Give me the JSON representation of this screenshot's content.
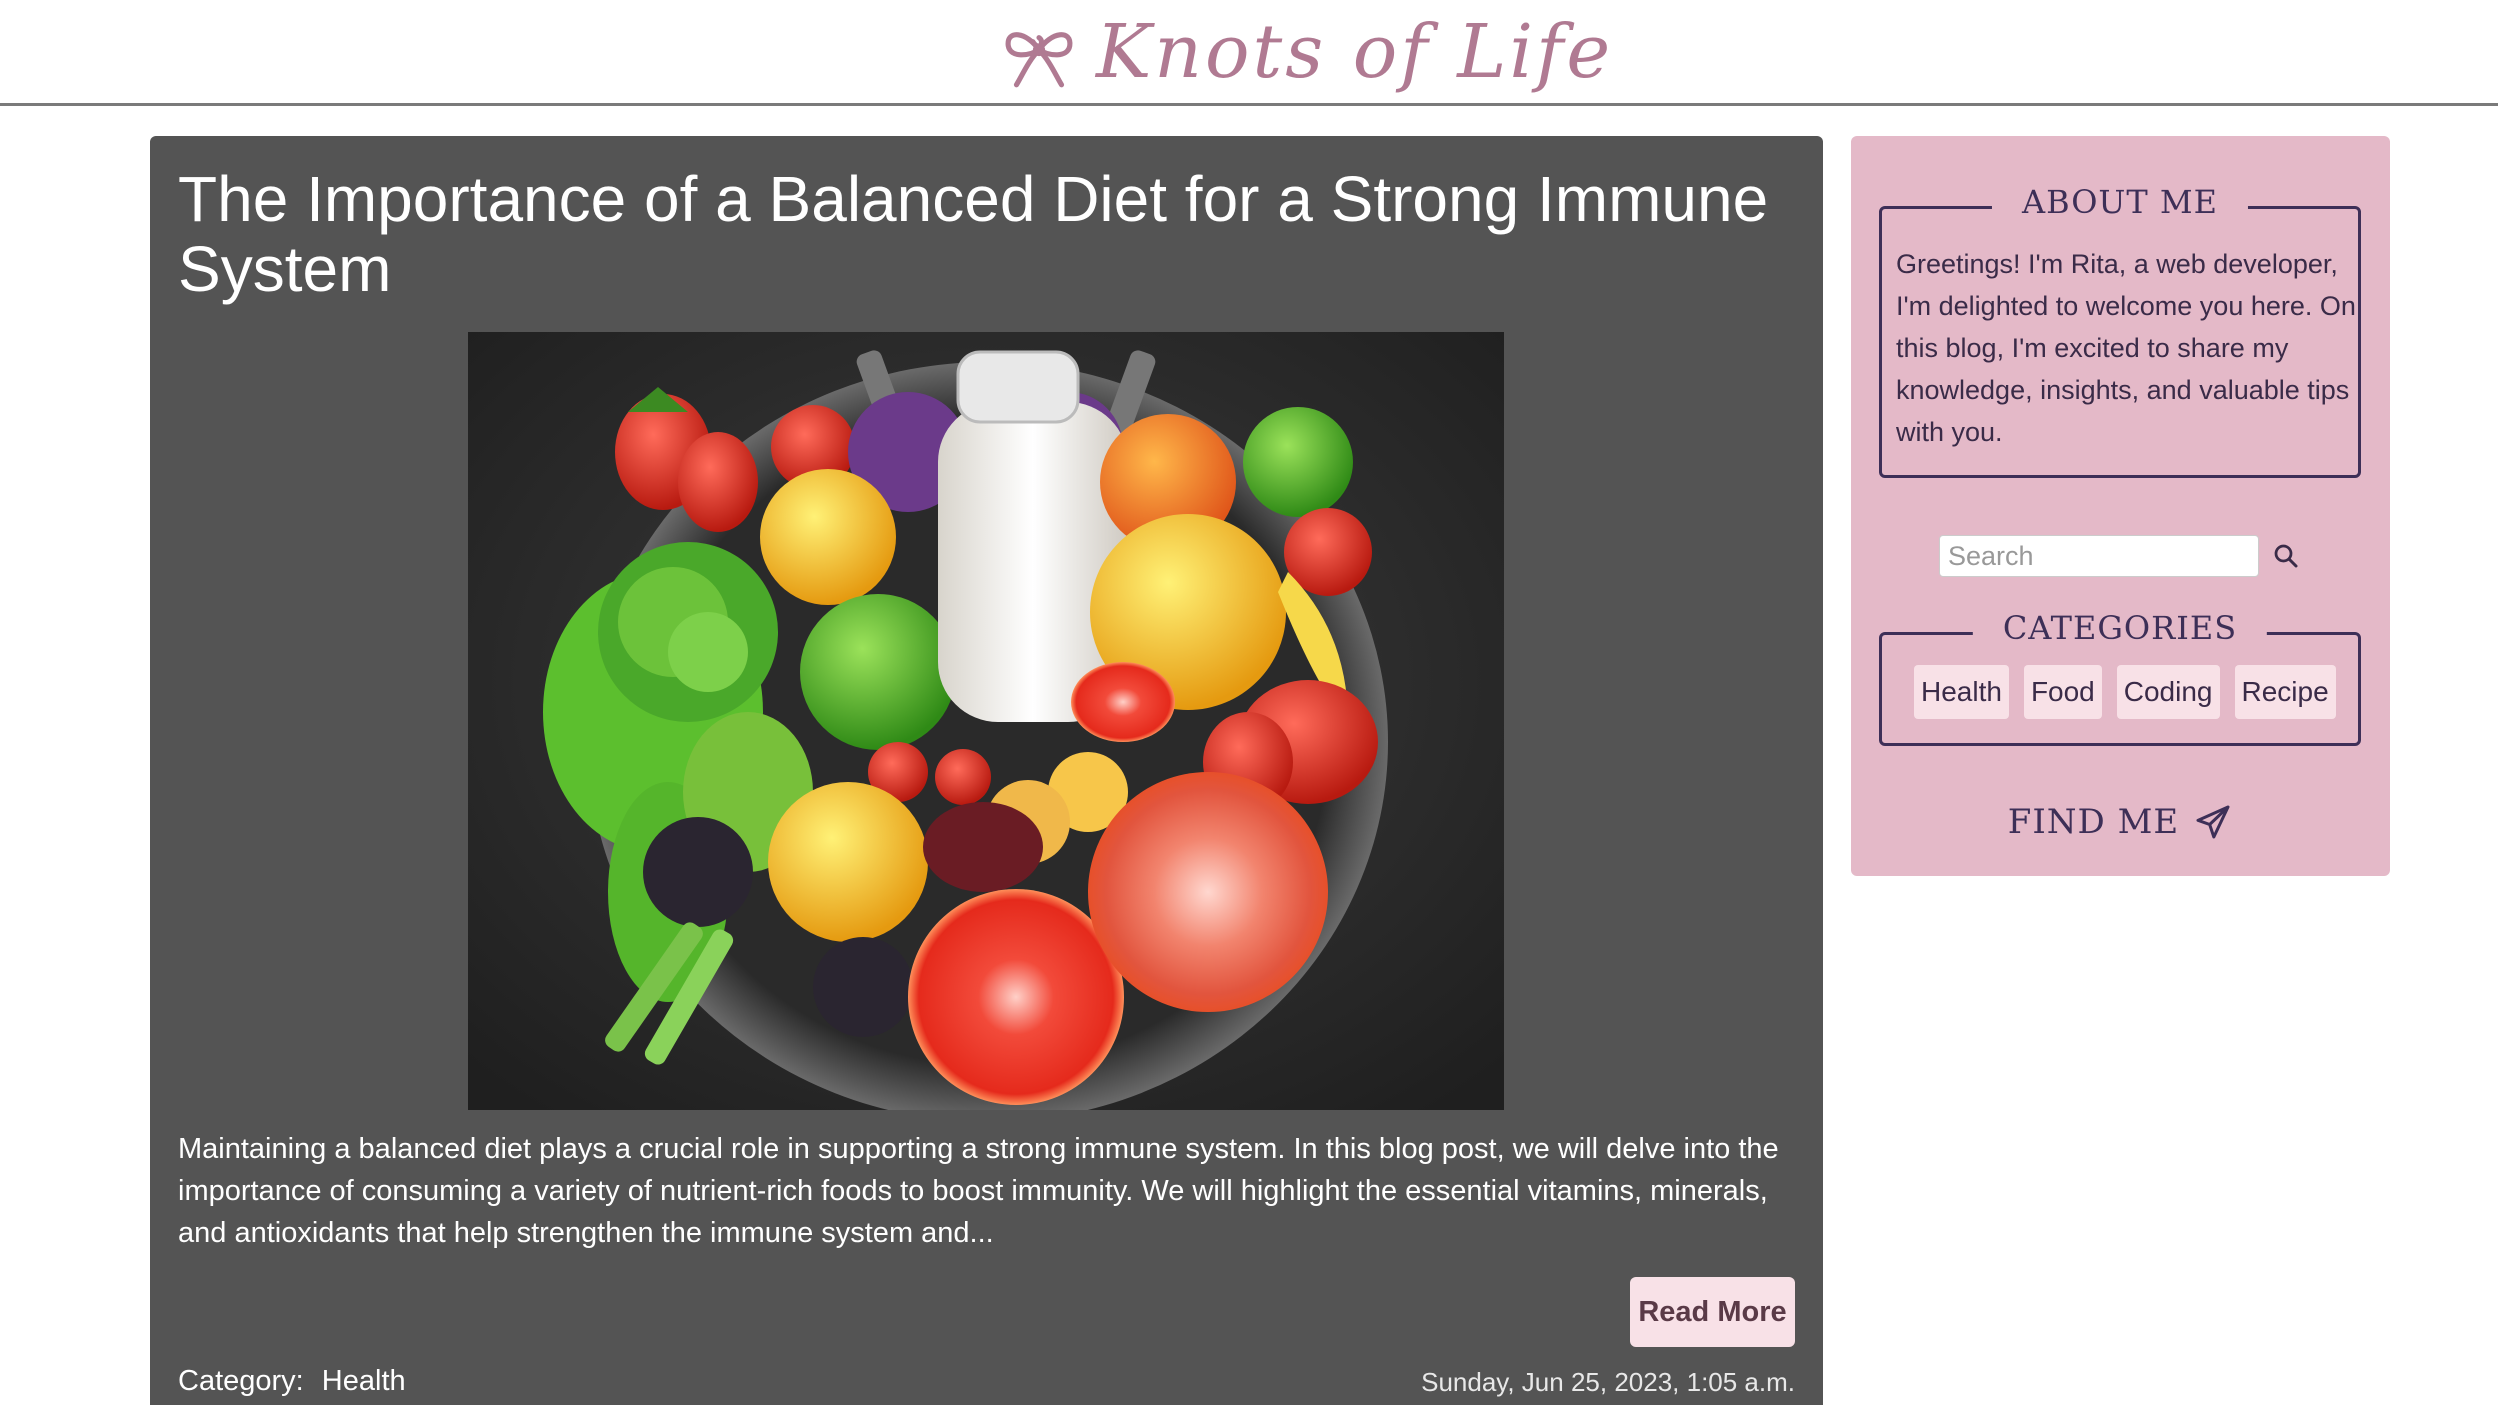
{
  "header": {
    "brand_name": "Knots of Life",
    "logo_icon": "ribbon-knot-icon",
    "brand_color": "#b07a92"
  },
  "post": {
    "title": "The Importance of a Balanced Diet for a Strong Immune System",
    "image_icon": "healthy-food-bowl-image",
    "excerpt": "Maintaining a balanced diet plays a crucial role in supporting a strong immune system. In this blog post, we will delve into the importance of consuming a variety of nutrient-rich foods to boost immunity. We will highlight the essential vitamins, minerals, and antioxidants that help strengthen the immune system and...",
    "read_more_label": "Read More",
    "category_label": "Category:",
    "category_value": "Health",
    "date": "Sunday, Jun 25, 2023, 1:05 a.m.",
    "card_color": "#545454"
  },
  "sidebar": {
    "background_color": "#e4b9c8",
    "about": {
      "heading": "ABOUT ME",
      "text": "Greetings! I'm Rita, a web developer, I'm delighted to welcome you here. On this blog, I'm excited to share my knowledge, insights, and valuable tips with you."
    },
    "search": {
      "placeholder": "Search",
      "value": "",
      "icon": "search-icon"
    },
    "categories": {
      "heading": "CATEGORIES",
      "items": [
        "Health",
        "Food",
        "Coding",
        "Recipe"
      ]
    },
    "find_me": {
      "label": "FIND ME",
      "icon": "paper-plane-icon"
    }
  }
}
